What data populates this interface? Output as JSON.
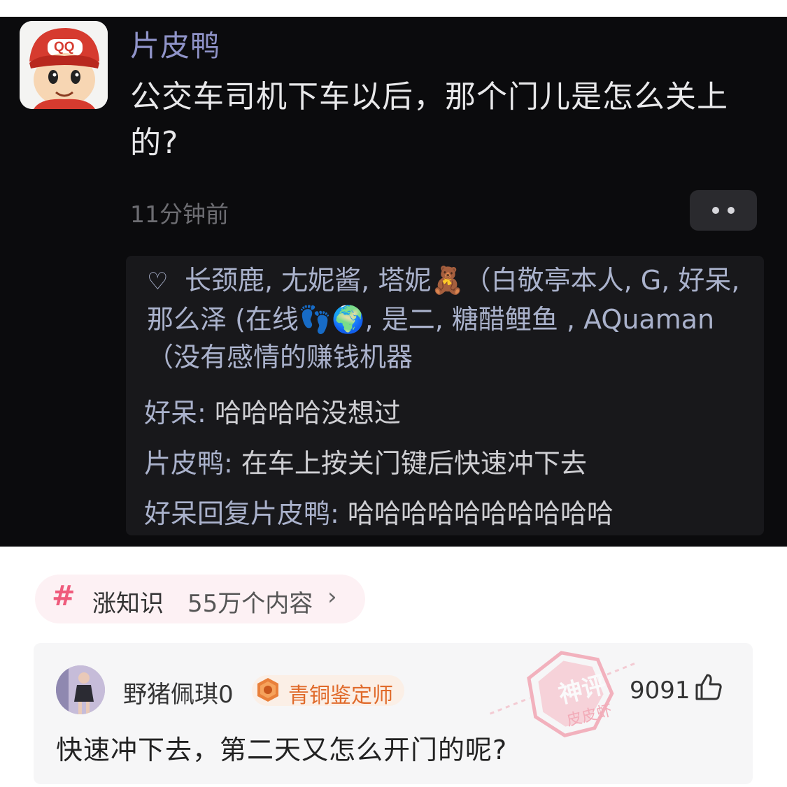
{
  "post": {
    "avatar_badge": "QQ",
    "author": "片皮鸭",
    "text": "公交车司机下车以后，那个门儿是怎么关上的?",
    "time": "11分钟前",
    "more_icon": "more-dots-icon"
  },
  "interactions": {
    "likes_text": "长颈鹿, 尢妮酱, 塔妮🧸（白敬亭本人, G, 好呆, 那么泽 (在线👣🌍, 是二, 糖醋鲤鱼 , AQuaman（没有感情的赚钱机器",
    "comments": [
      {
        "user": "好呆",
        "sep": ": ",
        "text": "哈哈哈哈没想过"
      },
      {
        "user": "片皮鸭",
        "sep": ": ",
        "text": "在车上按关门键后快速冲下去"
      },
      {
        "user": "好呆回复片皮鸭",
        "sep": ": ",
        "text": "哈哈哈哈哈哈哈哈哈哈"
      }
    ]
  },
  "topic": {
    "icon": "#",
    "name": "涨知识",
    "count": "55万个内容",
    "chevron": "›"
  },
  "comment": {
    "user": "野猪佩琪0",
    "badge": "青铜鉴定师",
    "likes": "9091",
    "text": "快速冲下去，第二天又怎么开门的呢?",
    "watermark_top": "神评",
    "watermark_bottom": "皮皮虾"
  },
  "colors": {
    "dark_bg": "#0b0b0d",
    "author_color": "#8f93c8",
    "topic_pink": "#ef5b7c",
    "badge_orange": "#e06a2a"
  }
}
